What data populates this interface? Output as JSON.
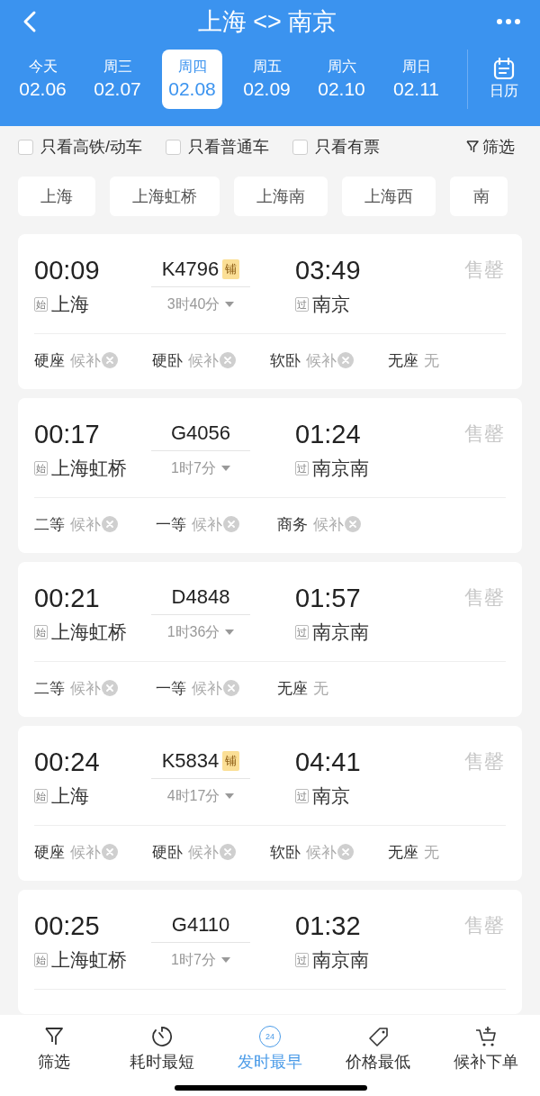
{
  "header": {
    "title": "上海 <> 南京",
    "calendar_label": "日历"
  },
  "dates": [
    {
      "day": "今天",
      "date": "02.06",
      "selected": false
    },
    {
      "day": "周三",
      "date": "02.07",
      "selected": false
    },
    {
      "day": "周四",
      "date": "02.08",
      "selected": true
    },
    {
      "day": "周五",
      "date": "02.09",
      "selected": false
    },
    {
      "day": "周六",
      "date": "02.10",
      "selected": false
    },
    {
      "day": "周日",
      "date": "02.11",
      "selected": false
    }
  ],
  "filters": [
    {
      "label": "只看高铁/动车",
      "checked": false
    },
    {
      "label": "只看普通车",
      "checked": false
    },
    {
      "label": "只看有票",
      "checked": false
    }
  ],
  "filter_button": "筛选",
  "stations": [
    "上海",
    "上海虹桥",
    "上海南",
    "上海西",
    "南"
  ],
  "trains": [
    {
      "depart": "00:09",
      "train": "K4796",
      "tag": "铺",
      "duration": "3时40分",
      "arrive": "03:49",
      "from_mark": "始",
      "from": "上海",
      "to_mark": "过",
      "to": "南京",
      "status": "售罄",
      "seats": [
        {
          "name": "硬座",
          "status": "候补",
          "kind": "waitlist"
        },
        {
          "name": "硬卧",
          "status": "候补",
          "kind": "waitlist"
        },
        {
          "name": "软卧",
          "status": "候补",
          "kind": "waitlist"
        },
        {
          "name": "无座",
          "status": "无",
          "kind": "none"
        }
      ]
    },
    {
      "depart": "00:17",
      "train": "G4056",
      "duration": "1时7分",
      "arrive": "01:24",
      "from_mark": "始",
      "from": "上海虹桥",
      "to_mark": "过",
      "to": "南京南",
      "status": "售罄",
      "seats": [
        {
          "name": "二等",
          "status": "候补",
          "kind": "waitlist"
        },
        {
          "name": "一等",
          "status": "候补",
          "kind": "waitlist"
        },
        {
          "name": "商务",
          "status": "候补",
          "kind": "waitlist"
        }
      ]
    },
    {
      "depart": "00:21",
      "train": "D4848",
      "duration": "1时36分",
      "arrive": "01:57",
      "from_mark": "始",
      "from": "上海虹桥",
      "to_mark": "过",
      "to": "南京南",
      "status": "售罄",
      "seats": [
        {
          "name": "二等",
          "status": "候补",
          "kind": "waitlist"
        },
        {
          "name": "一等",
          "status": "候补",
          "kind": "waitlist"
        },
        {
          "name": "无座",
          "status": "无",
          "kind": "none"
        }
      ]
    },
    {
      "depart": "00:24",
      "train": "K5834",
      "tag": "铺",
      "duration": "4时17分",
      "arrive": "04:41",
      "from_mark": "始",
      "from": "上海",
      "to_mark": "过",
      "to": "南京",
      "status": "售罄",
      "seats": [
        {
          "name": "硬座",
          "status": "候补",
          "kind": "waitlist"
        },
        {
          "name": "硬卧",
          "status": "候补",
          "kind": "waitlist"
        },
        {
          "name": "软卧",
          "status": "候补",
          "kind": "waitlist"
        },
        {
          "name": "无座",
          "status": "无",
          "kind": "none"
        }
      ]
    },
    {
      "depart": "00:25",
      "train": "G4110",
      "duration": "1时7分",
      "arrive": "01:32",
      "from_mark": "始",
      "from": "上海虹桥",
      "to_mark": "过",
      "to": "南京南",
      "status": "售罄"
    }
  ],
  "bottom_nav": [
    {
      "label": "筛选",
      "kind": "filter",
      "selected": false
    },
    {
      "label": "耗时最短",
      "kind": "timer",
      "selected": false
    },
    {
      "label": "发时最早",
      "kind": "clock24",
      "badge": "24",
      "selected": true
    },
    {
      "label": "价格最低",
      "kind": "tag",
      "selected": false
    },
    {
      "label": "候补下单",
      "kind": "cart",
      "selected": false
    }
  ]
}
